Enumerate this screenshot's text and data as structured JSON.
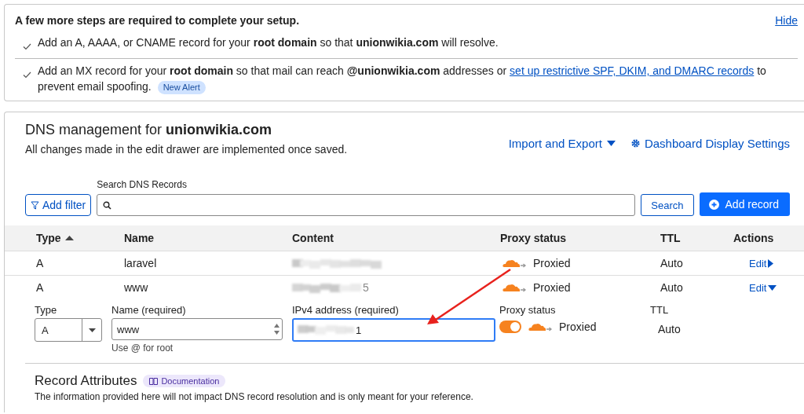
{
  "setup_banner": {
    "title": "A few more steps are required to complete your setup.",
    "hide_link": "Hide",
    "steps": [
      {
        "text": "Add an A, AAAA, or CNAME record for your **root domain** so that **unionwikia.com** will resolve.",
        "checked": true
      },
      {
        "text": "Add an MX record for your **root domain** so that mail can reach **@unionwikia.com** addresses or ",
        "link": "set up restrictive SPF, DKIM, and DMARC records",
        "text_after": " to prevent email spoofing.",
        "badge": "New Alert",
        "checked": true
      }
    ]
  },
  "dns": {
    "title": "DNS management for **unionwikia.com**",
    "subtitle": "All changes made in the edit drawer are implemented once saved.",
    "import_export": "Import and Export",
    "display_settings": "Dashboard Display Settings",
    "filter_button": "Add filter",
    "search_label": "Search DNS Records",
    "search_button": "Search",
    "add_button": "Add record",
    "columns": [
      {
        "label": "Type",
        "sorted_ascending": true
      },
      {
        "label": "Name"
      },
      {
        "label": "Content"
      },
      {
        "label": "Proxy status"
      },
      {
        "label": "TTL"
      },
      {
        "label": "Actions"
      }
    ],
    "rows": [
      {
        "type": "A",
        "name": "laravel",
        "proxy": "Proxied",
        "ttl": "Auto",
        "action": "Edit",
        "expanded": false
      },
      {
        "type": "A",
        "name": "www",
        "content_visible": "5",
        "proxy": "Proxied",
        "ttl": "Auto",
        "action": "Edit",
        "expanded": true
      }
    ],
    "editor": {
      "type_label": "Type",
      "type_value": "A",
      "name_label": "Name (required)",
      "name_value": "www",
      "name_hint": "Use @ for root",
      "ip_label": "IPv4 address (required)",
      "ip_value_visible": "1",
      "proxy_label": "Proxy status",
      "proxy_on": true,
      "proxy_text": "Proxied",
      "ttl_label": "TTL",
      "ttl_value": "Auto"
    },
    "record_attributes": {
      "title": "Record Attributes",
      "doc_badge": "Documentation",
      "text": "The information provided here will not impact DNS record resolution and is only meant for your reference."
    }
  }
}
